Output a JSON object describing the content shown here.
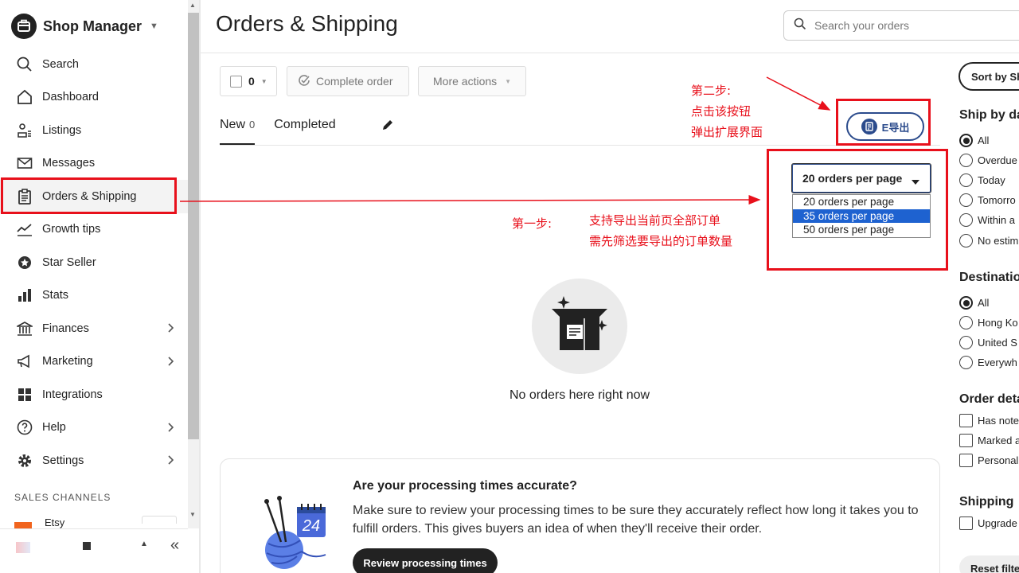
{
  "sidebar": {
    "brand_title": "Shop Manager",
    "nav": [
      {
        "label": "Search",
        "icon": "search-icon"
      },
      {
        "label": "Dashboard",
        "icon": "home-icon"
      },
      {
        "label": "Listings",
        "icon": "listings-icon"
      },
      {
        "label": "Messages",
        "icon": "envelope-icon"
      },
      {
        "label": "Orders & Shipping",
        "icon": "clipboard-icon",
        "active": true
      },
      {
        "label": "Growth tips",
        "icon": "growth-icon"
      },
      {
        "label": "Star Seller",
        "icon": "star-badge-icon"
      },
      {
        "label": "Stats",
        "icon": "bar-chart-icon"
      },
      {
        "label": "Finances",
        "icon": "bank-icon",
        "has_submenu": true
      },
      {
        "label": "Marketing",
        "icon": "megaphone-icon",
        "has_submenu": true
      },
      {
        "label": "Integrations",
        "icon": "grid-icon"
      },
      {
        "label": "Help",
        "icon": "help-icon",
        "has_submenu": true
      },
      {
        "label": "Settings",
        "icon": "gear-icon",
        "has_submenu": true
      }
    ],
    "sales_channels_label": "SALES CHANNELS",
    "etsy_label": "Etsy",
    "collapse_symbol": "«"
  },
  "header": {
    "title": "Orders & Shipping",
    "search_placeholder": "Search your orders"
  },
  "toolbar": {
    "selected_count": "0",
    "complete_label": "Complete order",
    "more_label": "More actions"
  },
  "tabs": {
    "new_label": "New",
    "new_count": "0",
    "completed_label": "Completed"
  },
  "export_button": {
    "label": "E导出"
  },
  "per_page": {
    "selected": "20 orders per page",
    "options": [
      "20 orders per page",
      "35 orders per page",
      "50 orders per page"
    ],
    "highlighted_index": 1
  },
  "annotations": {
    "step2_line1": "第二步:",
    "step2_line2": "点击该按钮",
    "step2_line3": "弹出扩展界面",
    "step1_label": "第一步:",
    "step1_line1": "支持导出当前页全部订单",
    "step1_line2": "需先筛选要导出的订单数量",
    "color": "#e8101b"
  },
  "empty_state": {
    "text": "No orders here right now"
  },
  "processing_card": {
    "title": "Are your processing times accurate?",
    "body": "Make sure to review your processing times to be sure they accurately reflect how long it takes you to fulfill orders. This gives buyers an idea of when they'll receive their order.",
    "button_label": "Review processing times",
    "calendar_number": "24"
  },
  "filters": {
    "sort_label": "Sort by Sh",
    "ship_by_heading": "Ship by da",
    "ship_by_options": [
      {
        "label": "All",
        "checked": true
      },
      {
        "label": "Overdue",
        "checked": false
      },
      {
        "label": "Today",
        "checked": false
      },
      {
        "label": "Tomorro",
        "checked": false
      },
      {
        "label": "Within a",
        "checked": false
      },
      {
        "label": "No estim",
        "checked": false
      }
    ],
    "destination_heading": "Destinatio",
    "destination_options": [
      {
        "label": "All",
        "checked": true
      },
      {
        "label": "Hong Ko",
        "checked": false
      },
      {
        "label": "United S",
        "checked": false
      },
      {
        "label": "Everywh",
        "checked": false
      }
    ],
    "order_details_heading": "Order deta",
    "order_details_options": [
      "Has note",
      "Marked a",
      "Personal"
    ],
    "shipping_heading": "Shipping",
    "shipping_options": [
      "Upgrade"
    ],
    "reset_label": "Reset filte"
  }
}
